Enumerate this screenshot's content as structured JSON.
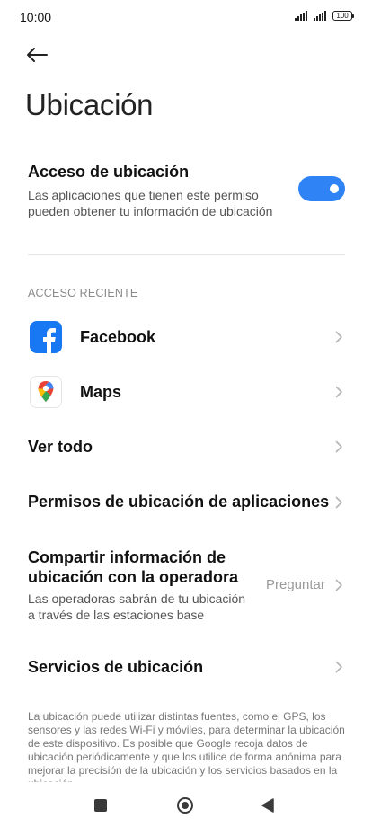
{
  "status_bar": {
    "time": "10:00",
    "battery": "100"
  },
  "header": {
    "title": "Ubicación"
  },
  "location_access": {
    "title": "Acceso de ubicación",
    "description_line1": "Las aplicaciones que tienen este permiso",
    "description_line2": "pueden obtener tu información de ubicación",
    "enabled": true
  },
  "recent": {
    "label": "ACCESO RECIENTE",
    "apps": [
      {
        "name": "Facebook",
        "icon": "facebook-icon"
      },
      {
        "name": "Maps",
        "icon": "maps-icon"
      }
    ],
    "see_all": "Ver todo"
  },
  "app_permissions": {
    "title": "Permisos de ubicación de aplicaciones"
  },
  "carrier_share": {
    "title_line1": "Compartir información de",
    "title_line2": "ubicación con la operadora",
    "value": "Preguntar",
    "description_line1": "Las operadoras sabrán de tu ubicación",
    "description_line2": "a través de las estaciones base"
  },
  "location_services": {
    "title": "Servicios de ubicación"
  },
  "footnote": "La ubicación puede utilizar distintas fuentes, como el GPS, los sensores y las redes Wi-Fi y móviles, para determinar la ubicación de este dispositivo. Es posible que Google recoja datos de ubicación periódicamente y que los utilice de forma anónima para mejorar la precisión de la ubicación y los servicios basados en la ubicación.",
  "colors": {
    "accent": "#2f83f4",
    "facebook": "#1877f2"
  }
}
